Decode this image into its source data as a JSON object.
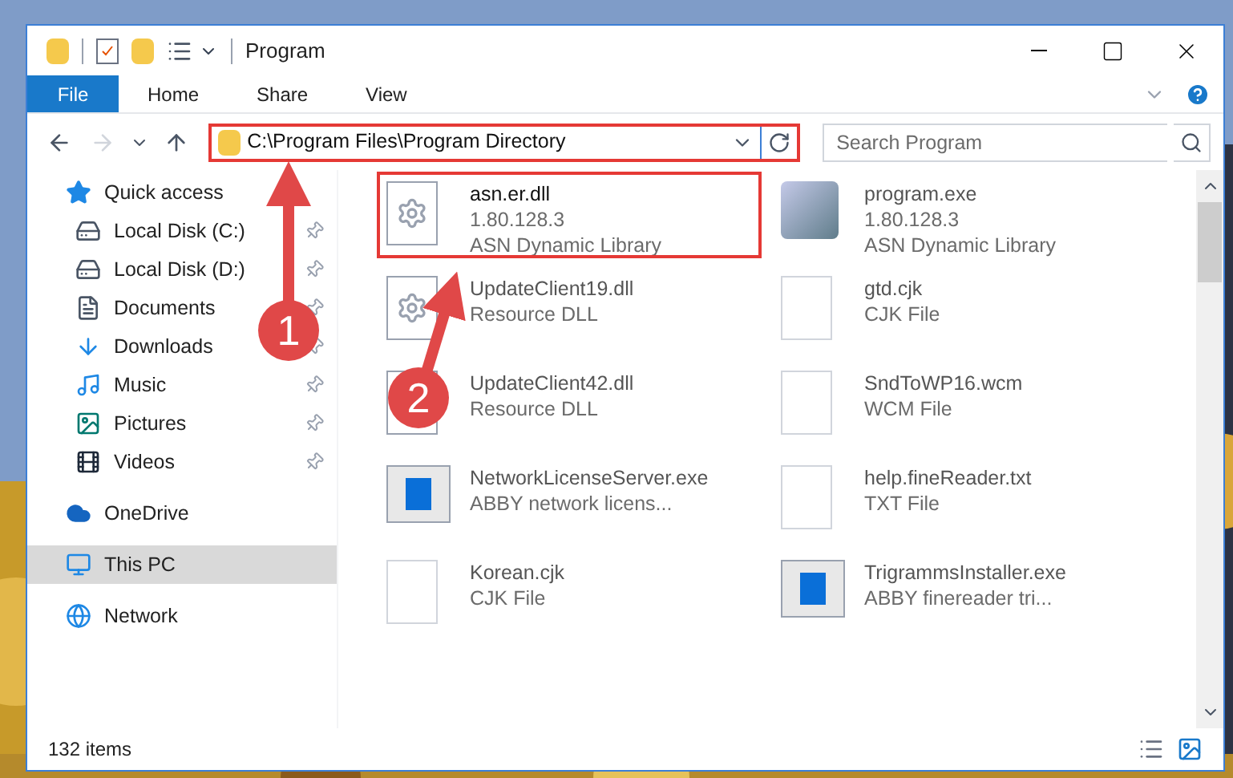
{
  "window": {
    "title": "Program"
  },
  "ribbon_tabs": [
    {
      "label": "File",
      "selected": true
    },
    {
      "label": "Home",
      "selected": false
    },
    {
      "label": "Share",
      "selected": false
    },
    {
      "label": "View",
      "selected": false
    }
  ],
  "address": {
    "path": "C:\\Program Files\\Program Directory",
    "highlighted": true
  },
  "search": {
    "placeholder": "Search Program"
  },
  "sidebar": {
    "items": [
      {
        "label": "Quick access",
        "kind": "star",
        "selected": false,
        "children": [
          {
            "label": "Local Disk (C:)",
            "kind": "disk",
            "pinned": true,
            "selected": false
          },
          {
            "label": "Local Disk (D:)",
            "kind": "disk",
            "pinned": true,
            "selected": false
          },
          {
            "label": "Documents",
            "kind": "doc",
            "pinned": true,
            "selected": false
          },
          {
            "label": "Downloads",
            "kind": "download",
            "pinned": true,
            "selected": false
          },
          {
            "label": "Music",
            "kind": "music",
            "pinned": true,
            "selected": false
          },
          {
            "label": "Pictures",
            "kind": "pictures",
            "pinned": true,
            "selected": false
          },
          {
            "label": "Videos",
            "kind": "videos",
            "pinned": true,
            "selected": false
          }
        ]
      },
      {
        "label": "OneDrive",
        "kind": "cloud",
        "selected": false
      },
      {
        "label": "This PC",
        "kind": "pc",
        "selected": true
      },
      {
        "label": "Network",
        "kind": "network",
        "selected": false
      }
    ]
  },
  "files": [
    {
      "name": "asn.er.dll",
      "lines": [
        "1.80.128.3",
        "ASN Dynamic Library"
      ],
      "kind": "dll",
      "highlighted": true
    },
    {
      "name": "program.exe",
      "lines": [
        "1.80.128.3",
        "ASN Dynamic Library"
      ],
      "kind": "setup",
      "highlighted": false
    },
    {
      "name": "UpdateClient19.dll",
      "lines": [
        "Resource DLL"
      ],
      "kind": "dll",
      "highlighted": false
    },
    {
      "name": "gtd.cjk",
      "lines": [
        "CJK File"
      ],
      "kind": "blank",
      "highlighted": false
    },
    {
      "name": "UpdateClient42.dll",
      "lines": [
        "Resource DLL"
      ],
      "kind": "dll",
      "highlighted": false
    },
    {
      "name": "SndToWP16.wcm",
      "lines": [
        "WCM File"
      ],
      "kind": "blank",
      "highlighted": false
    },
    {
      "name": "NetworkLicenseServer.exe",
      "lines": [
        "ABBY network licens..."
      ],
      "kind": "app",
      "highlighted": false
    },
    {
      "name": "help.fineReader.txt",
      "lines": [
        "TXT File"
      ],
      "kind": "blank",
      "highlighted": false
    },
    {
      "name": "Korean.cjk",
      "lines": [
        "CJK File"
      ],
      "kind": "blank",
      "highlighted": false
    },
    {
      "name": "TrigrammsInstaller.exe",
      "lines": [
        "ABBY finereader tri..."
      ],
      "kind": "app",
      "highlighted": false
    }
  ],
  "status_bar": {
    "count": "132 items"
  },
  "annotations": [
    {
      "label": "1"
    },
    {
      "label": "2"
    }
  ]
}
